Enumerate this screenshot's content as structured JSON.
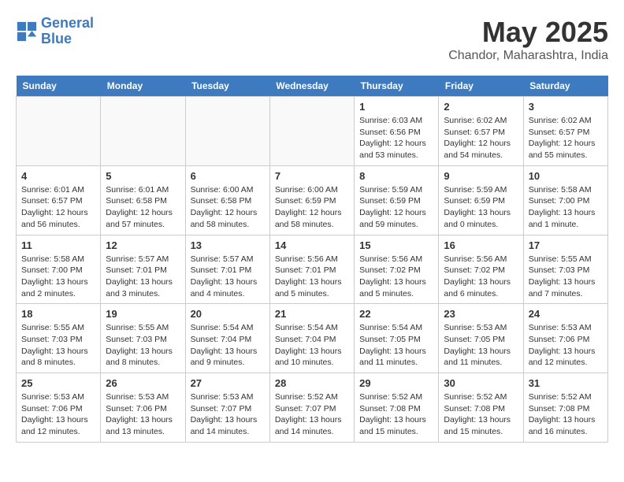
{
  "header": {
    "logo_line1": "General",
    "logo_line2": "Blue",
    "month": "May 2025",
    "location": "Chandor, Maharashtra, India"
  },
  "weekdays": [
    "Sunday",
    "Monday",
    "Tuesday",
    "Wednesday",
    "Thursday",
    "Friday",
    "Saturday"
  ],
  "weeks": [
    [
      {
        "day": "",
        "info": "",
        "empty": true
      },
      {
        "day": "",
        "info": "",
        "empty": true
      },
      {
        "day": "",
        "info": "",
        "empty": true
      },
      {
        "day": "",
        "info": "",
        "empty": true
      },
      {
        "day": "1",
        "info": "Sunrise: 6:03 AM\nSunset: 6:56 PM\nDaylight: 12 hours\nand 53 minutes.",
        "empty": false
      },
      {
        "day": "2",
        "info": "Sunrise: 6:02 AM\nSunset: 6:57 PM\nDaylight: 12 hours\nand 54 minutes.",
        "empty": false
      },
      {
        "day": "3",
        "info": "Sunrise: 6:02 AM\nSunset: 6:57 PM\nDaylight: 12 hours\nand 55 minutes.",
        "empty": false
      }
    ],
    [
      {
        "day": "4",
        "info": "Sunrise: 6:01 AM\nSunset: 6:57 PM\nDaylight: 12 hours\nand 56 minutes.",
        "empty": false
      },
      {
        "day": "5",
        "info": "Sunrise: 6:01 AM\nSunset: 6:58 PM\nDaylight: 12 hours\nand 57 minutes.",
        "empty": false
      },
      {
        "day": "6",
        "info": "Sunrise: 6:00 AM\nSunset: 6:58 PM\nDaylight: 12 hours\nand 58 minutes.",
        "empty": false
      },
      {
        "day": "7",
        "info": "Sunrise: 6:00 AM\nSunset: 6:59 PM\nDaylight: 12 hours\nand 58 minutes.",
        "empty": false
      },
      {
        "day": "8",
        "info": "Sunrise: 5:59 AM\nSunset: 6:59 PM\nDaylight: 12 hours\nand 59 minutes.",
        "empty": false
      },
      {
        "day": "9",
        "info": "Sunrise: 5:59 AM\nSunset: 6:59 PM\nDaylight: 13 hours\nand 0 minutes.",
        "empty": false
      },
      {
        "day": "10",
        "info": "Sunrise: 5:58 AM\nSunset: 7:00 PM\nDaylight: 13 hours\nand 1 minute.",
        "empty": false
      }
    ],
    [
      {
        "day": "11",
        "info": "Sunrise: 5:58 AM\nSunset: 7:00 PM\nDaylight: 13 hours\nand 2 minutes.",
        "empty": false
      },
      {
        "day": "12",
        "info": "Sunrise: 5:57 AM\nSunset: 7:01 PM\nDaylight: 13 hours\nand 3 minutes.",
        "empty": false
      },
      {
        "day": "13",
        "info": "Sunrise: 5:57 AM\nSunset: 7:01 PM\nDaylight: 13 hours\nand 4 minutes.",
        "empty": false
      },
      {
        "day": "14",
        "info": "Sunrise: 5:56 AM\nSunset: 7:01 PM\nDaylight: 13 hours\nand 5 minutes.",
        "empty": false
      },
      {
        "day": "15",
        "info": "Sunrise: 5:56 AM\nSunset: 7:02 PM\nDaylight: 13 hours\nand 5 minutes.",
        "empty": false
      },
      {
        "day": "16",
        "info": "Sunrise: 5:56 AM\nSunset: 7:02 PM\nDaylight: 13 hours\nand 6 minutes.",
        "empty": false
      },
      {
        "day": "17",
        "info": "Sunrise: 5:55 AM\nSunset: 7:03 PM\nDaylight: 13 hours\nand 7 minutes.",
        "empty": false
      }
    ],
    [
      {
        "day": "18",
        "info": "Sunrise: 5:55 AM\nSunset: 7:03 PM\nDaylight: 13 hours\nand 8 minutes.",
        "empty": false
      },
      {
        "day": "19",
        "info": "Sunrise: 5:55 AM\nSunset: 7:03 PM\nDaylight: 13 hours\nand 8 minutes.",
        "empty": false
      },
      {
        "day": "20",
        "info": "Sunrise: 5:54 AM\nSunset: 7:04 PM\nDaylight: 13 hours\nand 9 minutes.",
        "empty": false
      },
      {
        "day": "21",
        "info": "Sunrise: 5:54 AM\nSunset: 7:04 PM\nDaylight: 13 hours\nand 10 minutes.",
        "empty": false
      },
      {
        "day": "22",
        "info": "Sunrise: 5:54 AM\nSunset: 7:05 PM\nDaylight: 13 hours\nand 11 minutes.",
        "empty": false
      },
      {
        "day": "23",
        "info": "Sunrise: 5:53 AM\nSunset: 7:05 PM\nDaylight: 13 hours\nand 11 minutes.",
        "empty": false
      },
      {
        "day": "24",
        "info": "Sunrise: 5:53 AM\nSunset: 7:06 PM\nDaylight: 13 hours\nand 12 minutes.",
        "empty": false
      }
    ],
    [
      {
        "day": "25",
        "info": "Sunrise: 5:53 AM\nSunset: 7:06 PM\nDaylight: 13 hours\nand 12 minutes.",
        "empty": false
      },
      {
        "day": "26",
        "info": "Sunrise: 5:53 AM\nSunset: 7:06 PM\nDaylight: 13 hours\nand 13 minutes.",
        "empty": false
      },
      {
        "day": "27",
        "info": "Sunrise: 5:53 AM\nSunset: 7:07 PM\nDaylight: 13 hours\nand 14 minutes.",
        "empty": false
      },
      {
        "day": "28",
        "info": "Sunrise: 5:52 AM\nSunset: 7:07 PM\nDaylight: 13 hours\nand 14 minutes.",
        "empty": false
      },
      {
        "day": "29",
        "info": "Sunrise: 5:52 AM\nSunset: 7:08 PM\nDaylight: 13 hours\nand 15 minutes.",
        "empty": false
      },
      {
        "day": "30",
        "info": "Sunrise: 5:52 AM\nSunset: 7:08 PM\nDaylight: 13 hours\nand 15 minutes.",
        "empty": false
      },
      {
        "day": "31",
        "info": "Sunrise: 5:52 AM\nSunset: 7:08 PM\nDaylight: 13 hours\nand 16 minutes.",
        "empty": false
      }
    ]
  ]
}
